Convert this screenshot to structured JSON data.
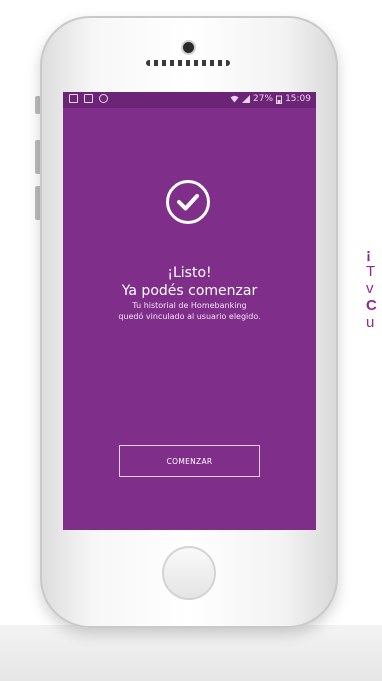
{
  "status_bar": {
    "time": "15:09",
    "battery": "27%",
    "icons": [
      "calendar-icon",
      "image-icon",
      "notification-icon",
      "wifi-icon",
      "signal-icon",
      "battery-icon"
    ]
  },
  "screen": {
    "title_line1": "¡Listo!",
    "title_line2": "Ya podés comenzar",
    "message_line1": "Tu historial de Homebanking",
    "message_line2": "quedó vinculado al usuario elegido.",
    "button_label": "COMENZAR"
  },
  "side_text": {
    "line1": "¡",
    "line2": "T",
    "line3": "v",
    "line4": "C",
    "line5": "u"
  },
  "colors": {
    "screen_bg": "#7f2f8a",
    "accent_text": "#8a2c8f"
  }
}
